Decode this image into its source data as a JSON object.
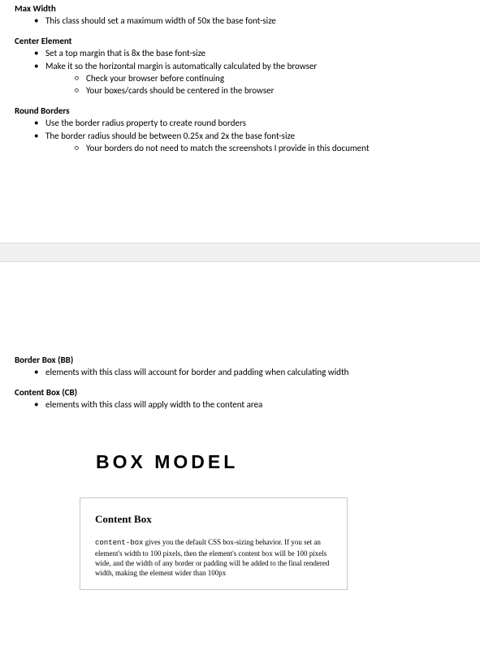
{
  "sections": {
    "maxWidth": {
      "heading": "Max Width",
      "items": [
        "This class should set a maximum width of 50x the base font-size"
      ]
    },
    "centerElement": {
      "heading": "Center Element",
      "items": [
        "Set a top margin that is 8x the base font-size",
        "Make it so the horizontal margin is automatically calculated by the browser"
      ],
      "subItemsFor1": [
        "Check your browser before continuing",
        "Your boxes/cards should be centered in the browser"
      ]
    },
    "roundBorders": {
      "heading": "Round Borders",
      "items": [
        "Use the border radius property to create round borders",
        "The border radius should be between 0.25x and 2x the base font-size"
      ],
      "subItemsFor1": [
        "Your borders do not need to match the screenshots I provide in this document"
      ]
    },
    "borderBox": {
      "heading": "Border Box (BB)",
      "items": [
        "elements with this class will account for border and padding when calculating width"
      ]
    },
    "contentBox": {
      "heading": "Content Box (CB)",
      "items": [
        "elements with this class will apply width to the content area"
      ]
    }
  },
  "model": {
    "title": "BOX MODEL",
    "card": {
      "title": "Content Box",
      "code": "content-box",
      "body": " gives you the default CSS box-sizing behavior. If you set an element's width to 100 pixels, then the element's content box will be 100 pixels wide, and the width of any border or padding will be added to the final rendered width, making the element wider than 100px"
    }
  }
}
